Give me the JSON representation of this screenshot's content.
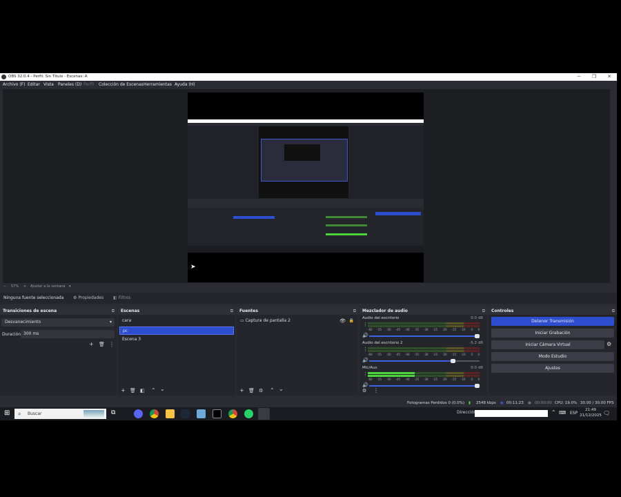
{
  "window": {
    "title": "OBS 32.0.4 - Perfil: Sin Título - Escenas: A",
    "min_glyph": "─",
    "max_glyph": "❐",
    "close_glyph": "✕"
  },
  "menu": [
    "Archivo (F)",
    "Editar",
    "Vista",
    "Paneles (D)",
    "Perfil",
    "Colección de Escenas",
    "Herramientas",
    "Ayuda (H)"
  ],
  "zoom": {
    "percent": "57%",
    "fit_label": "Ajustar a la ventana"
  },
  "source_toolbar": {
    "no_source": "Ninguna fuente seleccionada",
    "properties": "Propiedades",
    "filters": "Filtros"
  },
  "transitions": {
    "title": "Transiciones de escena",
    "selected": "Desvanecimiento",
    "duration_label": "Duración",
    "duration_value": "300 ms"
  },
  "scenes": {
    "title": "Escenas",
    "items": [
      "cara",
      "pc",
      "Escena 3"
    ],
    "selected_index": 1
  },
  "sources": {
    "title": "Fuentes",
    "items": [
      "Captura de pantalla 2"
    ]
  },
  "mixer": {
    "title": "Mezclador de audio",
    "channels": [
      {
        "name": "Audio del escritorio",
        "db": "0.0 dB",
        "level": 0.0,
        "volume": 1.0
      },
      {
        "name": "Audio del escritorio 2",
        "db": "-5.2 dB",
        "level": 0.0,
        "volume": 0.78
      },
      {
        "name": "Mic/Aux",
        "db": "0.0 dB",
        "level": 0.42,
        "volume": 1.0
      }
    ],
    "ticks": [
      "-60",
      "-55",
      "-50",
      "-45",
      "-40",
      "-35",
      "-30",
      "-25",
      "-20",
      "-15",
      "-10",
      "-5",
      "0"
    ]
  },
  "controls": {
    "title": "Controles",
    "buttons": [
      "Detener Transmisión",
      "Iniciar Grabación",
      "Iniciar Cámara Virtual",
      "Modo Estudio",
      "Ajustes"
    ]
  },
  "status": {
    "dropped": "Fotogramas Perdidos 0 (0.0%)",
    "bitrate": "2548 kbps",
    "stream_time": "00:11:23",
    "rec_time": "00:00:00",
    "cpu": "CPU: 19.0%",
    "fps": "30.00 / 30.00 FPS"
  },
  "taskbar": {
    "search_placeholder": "Buscar",
    "address_label": "Dirección",
    "lang": "ESP",
    "time": "21:49",
    "date": "21/12/2025"
  },
  "colors": {
    "accent": "#2e4ed1",
    "panel": "#25262c",
    "window": "#2b2c33"
  }
}
